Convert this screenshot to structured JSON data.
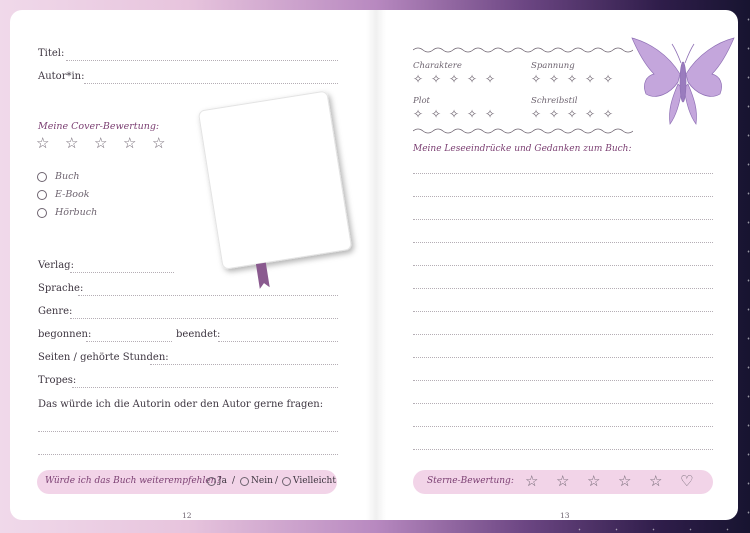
{
  "left": {
    "title_label": "Titel:",
    "author_label": "Autor*in:",
    "cover_rating_label": "Meine Cover-Bewertung:",
    "formats": [
      "Buch",
      "E-Book",
      "Hörbuch"
    ],
    "publisher_label": "Verlag:",
    "language_label": "Sprache:",
    "genre_label": "Genre:",
    "started_label": "begonnen:",
    "finished_label": "beendet:",
    "pages_label": "Seiten / gehörte Stunden:",
    "tropes_label": "Tropes:",
    "question_label": "Das würde ich die Autorin oder den Autor gerne fragen:",
    "recommend_question": "Würde ich das Buch weiterempfehlen?",
    "recommend_options": [
      "Ja",
      "Nein",
      "Vielleicht"
    ],
    "page_number": "12"
  },
  "right": {
    "categories": [
      "Charaktere",
      "Spannung",
      "Plot",
      "Schreibstil"
    ],
    "thoughts_label": "Meine Leseeindrücke und Gedanken zum Buch:",
    "rating_label": "Sterne-Bewertung:",
    "page_number": "13"
  },
  "icons": {
    "cover_star": "☆",
    "small_star": "✧",
    "heart": "♡",
    "butterfly": "butterfly-illustration"
  },
  "colors": {
    "accent": "#7b3f72",
    "pill": "#f2d4e8",
    "butterfly": "#b89ad0"
  }
}
